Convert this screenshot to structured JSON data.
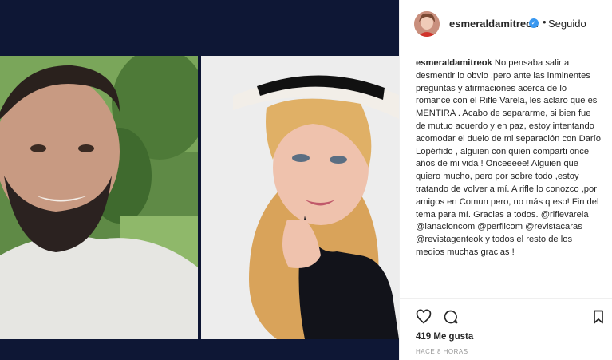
{
  "post": {
    "username": "esmeraldamitreok",
    "verified_icon": "verified-badge-icon",
    "separator": "•",
    "follow_status": "Seguido",
    "caption_user": "esmeraldamitreok",
    "caption_text": "No pensaba salir a desmentir lo obvio ,pero ante las inminentes preguntas y afirmaciones acerca de lo romance con el Rifle Varela, les aclaro que es MENTIRA . Acabo de separarme, si bien fue de mutuo acuerdo y en paz, estoy intentando acomodar el duelo de mi separación con Darío Lopérfido , alguien con quien comparti once años de mi vida ! Onceeeee! Alguien que quiero mucho, pero por sobre todo ,estoy tratando de volver a mí. A rifle lo conozco ,por amigos en Comun pero, no más q eso! Fin del tema para mí. Gracias a todos. @riflevarela @lanacioncom @perfilcom @revistacaras @revistagenteok y todos el resto de los medios muchas gracias !",
    "likes": "419 Me gusta",
    "timestamp": "HACE 8 HORAS"
  },
  "icons": {
    "like": "heart-icon",
    "comment": "comment-icon",
    "save": "bookmark-icon"
  },
  "colors": {
    "photo_band": "#0e1735",
    "verified": "#3897f0",
    "text": "#262626",
    "muted": "#999999"
  }
}
